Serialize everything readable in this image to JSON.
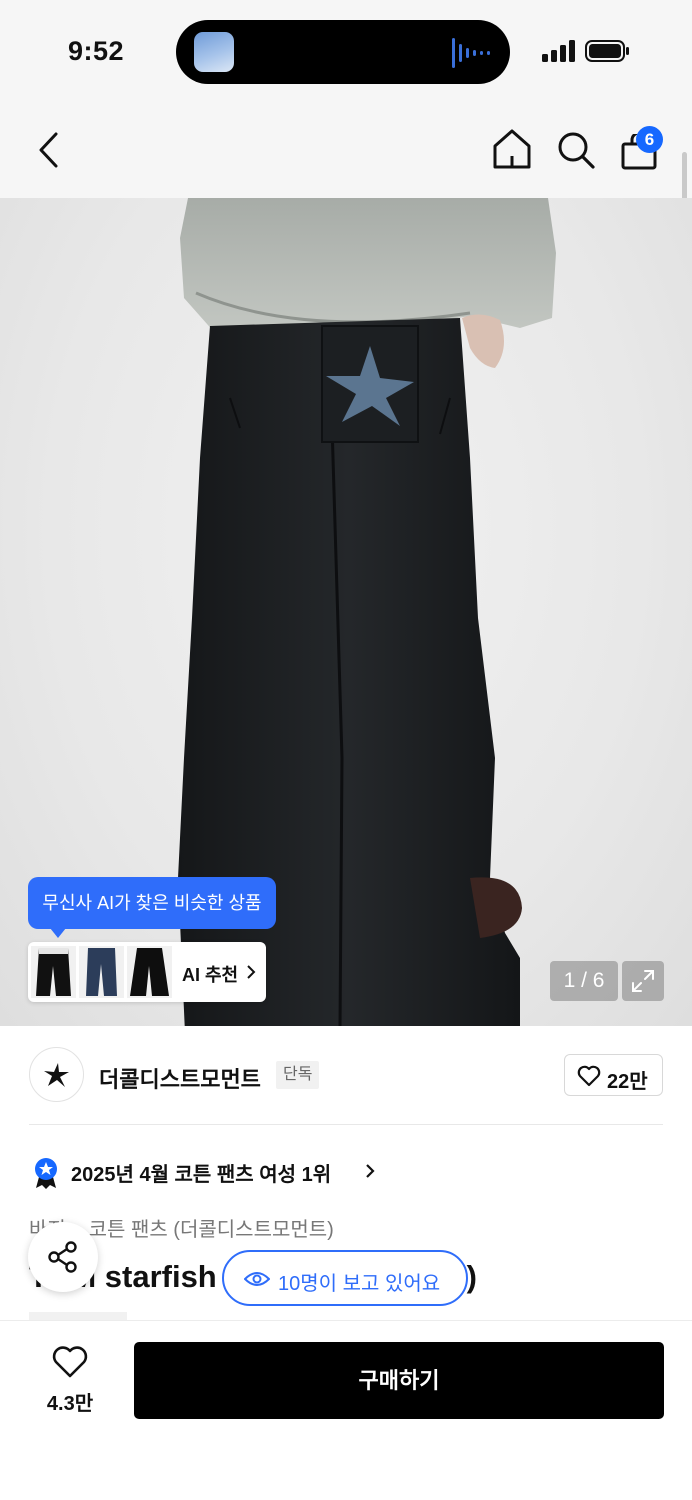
{
  "status_bar": {
    "time": "9:52"
  },
  "nav": {
    "cart_count": "6"
  },
  "gallery": {
    "ai_tooltip": "무신사 AI가 찾은 비슷한 상품",
    "ai_recommend_label": "AI 추천",
    "counter": "1 / 6"
  },
  "brand": {
    "name": "더콜디스트모먼트",
    "tag": "단독",
    "like_count": "22만"
  },
  "ranking": {
    "text": "2025년 4월 코튼 팬츠 여성 1위"
  },
  "breadcrumb": "바지 > 코튼 팬츠 (더콜디스트모먼트)",
  "product": {
    "title": "TCM starfish ",
    "title_end": "k)"
  },
  "viewers": {
    "text": "10명이 보고 있어요"
  },
  "bottom": {
    "favorite_count": "4.3만",
    "buy_label": "구매하기"
  },
  "colors": {
    "accent": "#2f6dfa",
    "badge": "#1668ff",
    "buy": "#000000"
  }
}
